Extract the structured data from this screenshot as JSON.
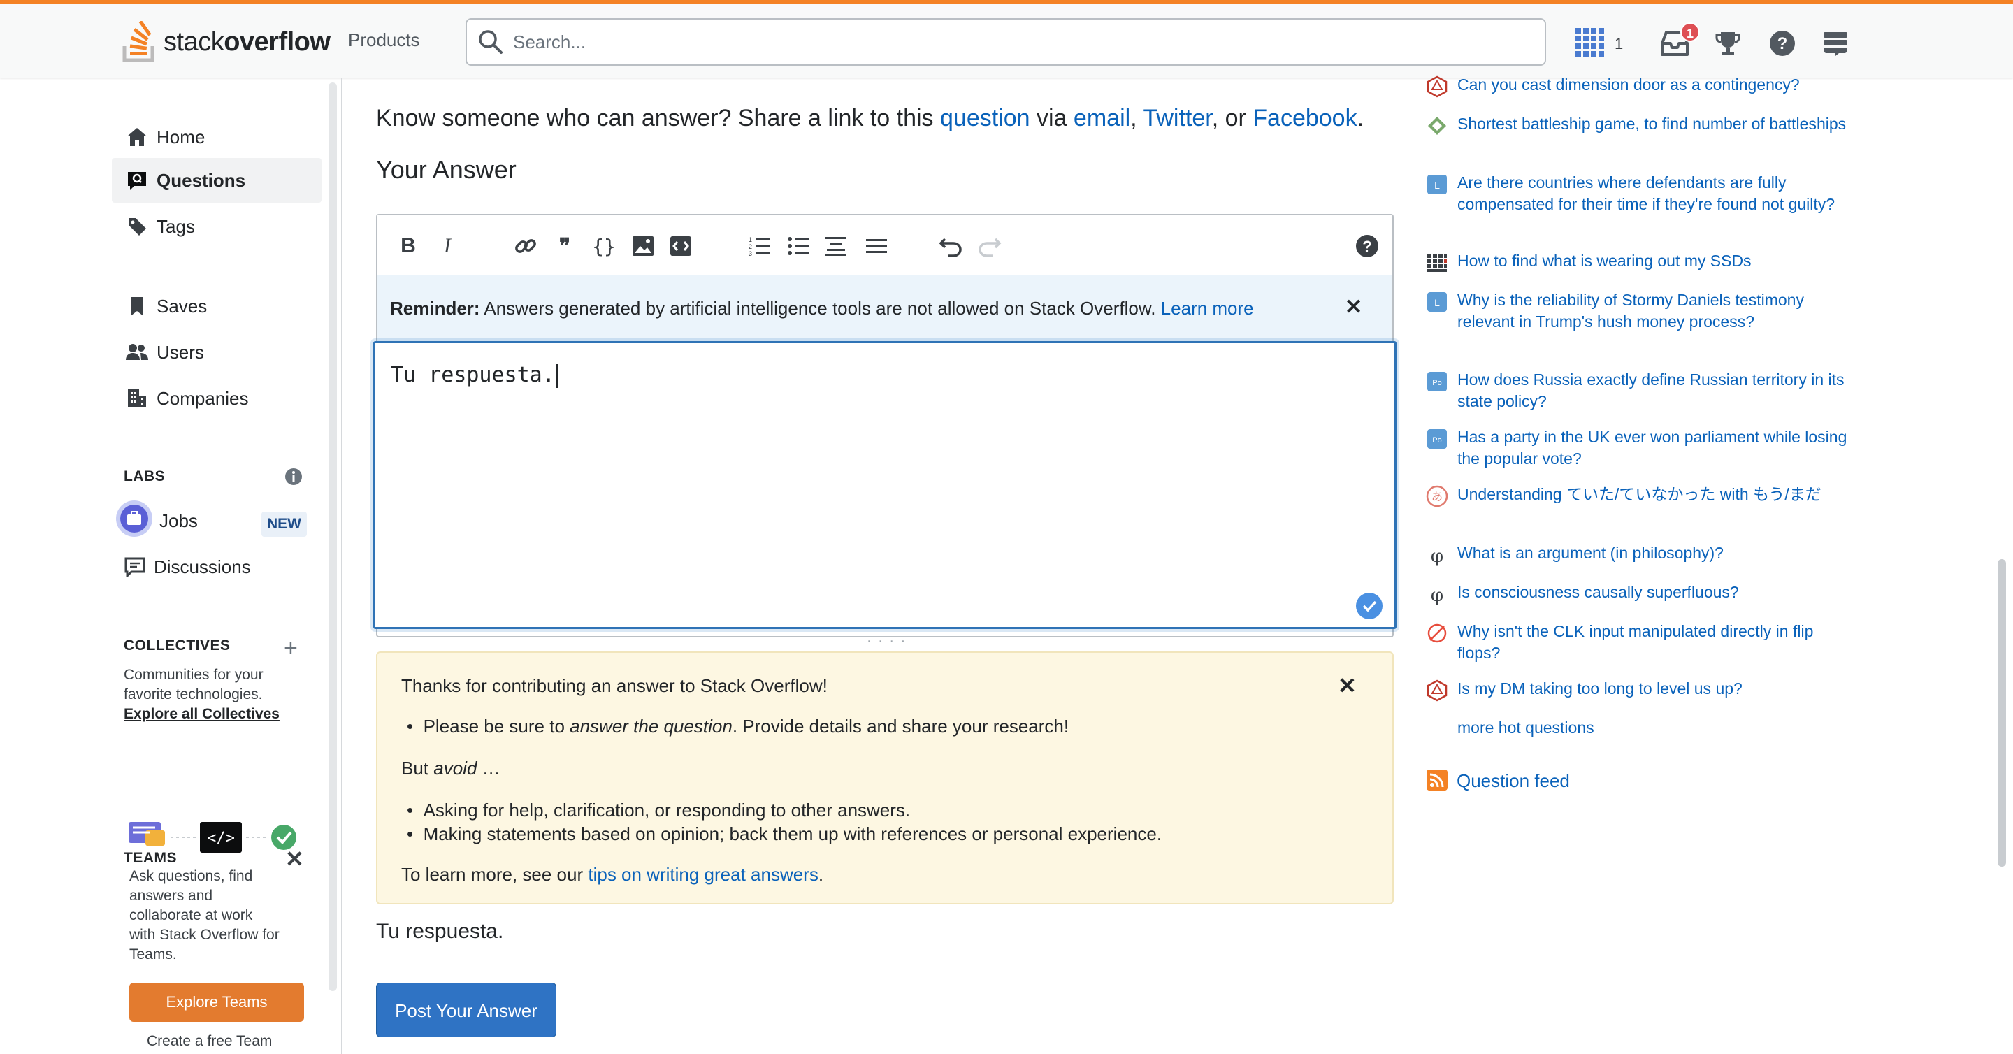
{
  "topbar": {
    "logo_text_light": "stack",
    "logo_text_bold": "overflow",
    "products": "Products",
    "search_placeholder": "Search...",
    "achievements_count": "1",
    "inbox_badge": "1"
  },
  "sidebar": {
    "items": [
      {
        "label": "Home",
        "icon": "home-icon"
      },
      {
        "label": "Questions",
        "icon": "questions-icon",
        "active": true
      },
      {
        "label": "Tags",
        "icon": "tag-icon"
      },
      {
        "label": "Saves",
        "icon": "bookmark-icon"
      },
      {
        "label": "Users",
        "icon": "users-icon"
      },
      {
        "label": "Companies",
        "icon": "building-icon"
      }
    ],
    "labs_title": "LABS",
    "labs_items": [
      {
        "label": "Jobs",
        "badge": "NEW"
      },
      {
        "label": "Discussions"
      }
    ],
    "collectives_title": "COLLECTIVES",
    "collectives_desc_1": "Communities for your",
    "collectives_desc_2": "favorite technologies.",
    "collectives_link": "Explore all Collectives",
    "teams_title": "TEAMS",
    "teams_desc": [
      "Ask questions, find",
      "answers and",
      "collaborate at work",
      "with Stack Overflow for",
      "Teams."
    ],
    "explore_teams": "Explore Teams",
    "create_team": "Create a free Team"
  },
  "main": {
    "share_prefix": "Know someone who can answer? Share a link to this ",
    "share_question": "question",
    "share_via": " via ",
    "share_email": "email",
    "share_twitter": "Twitter",
    "share_or": ", or ",
    "share_facebook": "Facebook",
    "your_answer_title": "Your Answer",
    "reminder_bold": "Reminder:",
    "reminder_text": " Answers generated by artificial intelligence tools are not allowed on Stack Overflow.",
    "reminder_link": "Learn more",
    "answer_value": "Tu respuesta.",
    "notice": {
      "title": "Thanks for contributing an answer to Stack Overflow!",
      "bullet1_pre": "Please be sure to ",
      "bullet1_em": "answer the question",
      "bullet1_post": ". Provide details and share your research!",
      "but_pre": "But ",
      "but_em": "avoid",
      "but_post": " …",
      "bullet2": "Asking for help, clarification, or responding to other answers.",
      "bullet3": "Making statements based on opinion; back them up with references or personal experience.",
      "learn_pre": "To learn more, see our ",
      "learn_link": "tips on writing great answers",
      "learn_post": "."
    },
    "preview_text": "Tu respuesta.",
    "post_button": "Post Your Answer"
  },
  "hot_questions": [
    {
      "title": "Can you cast dimension door as a contingency?",
      "icon": "dnd-icon"
    },
    {
      "title": "Shortest battleship game, to find number of battleships",
      "icon": "codegolf-icon"
    },
    {
      "title": "Are there countries where defendants are fully compensated for their time if they're found not guilty?",
      "icon": "law-icon"
    },
    {
      "title": "How to find what is wearing out my SSDs",
      "icon": "unix-icon"
    },
    {
      "title": "Why is the reliability of Stormy Daniels testimony relevant in Trump's hush money process?",
      "icon": "law-icon"
    },
    {
      "title": "How does Russia exactly define Russian territory in its state policy?",
      "icon": "politics-icon"
    },
    {
      "title": "Has a party in the UK ever won parliament while losing the popular vote?",
      "icon": "politics-icon"
    },
    {
      "title": "Understanding ていた/ていなかった with もう/まだ",
      "icon": "japanese-icon"
    },
    {
      "title": "What is an argument (in philosophy)?",
      "icon": "philosophy-icon"
    },
    {
      "title": "Is consciousness causally superfluous?",
      "icon": "philosophy-icon"
    },
    {
      "title": "Why isn't the CLK input manipulated directly in flip flops?",
      "icon": "electronics-icon"
    },
    {
      "title": "Is my DM taking too long to level us up?",
      "icon": "dnd-icon"
    }
  ],
  "more_hot": "more hot questions",
  "question_feed": "Question feed",
  "colors": {
    "brand": "#f48225",
    "link": "#0a62ba",
    "primary": "#2f73c4"
  }
}
